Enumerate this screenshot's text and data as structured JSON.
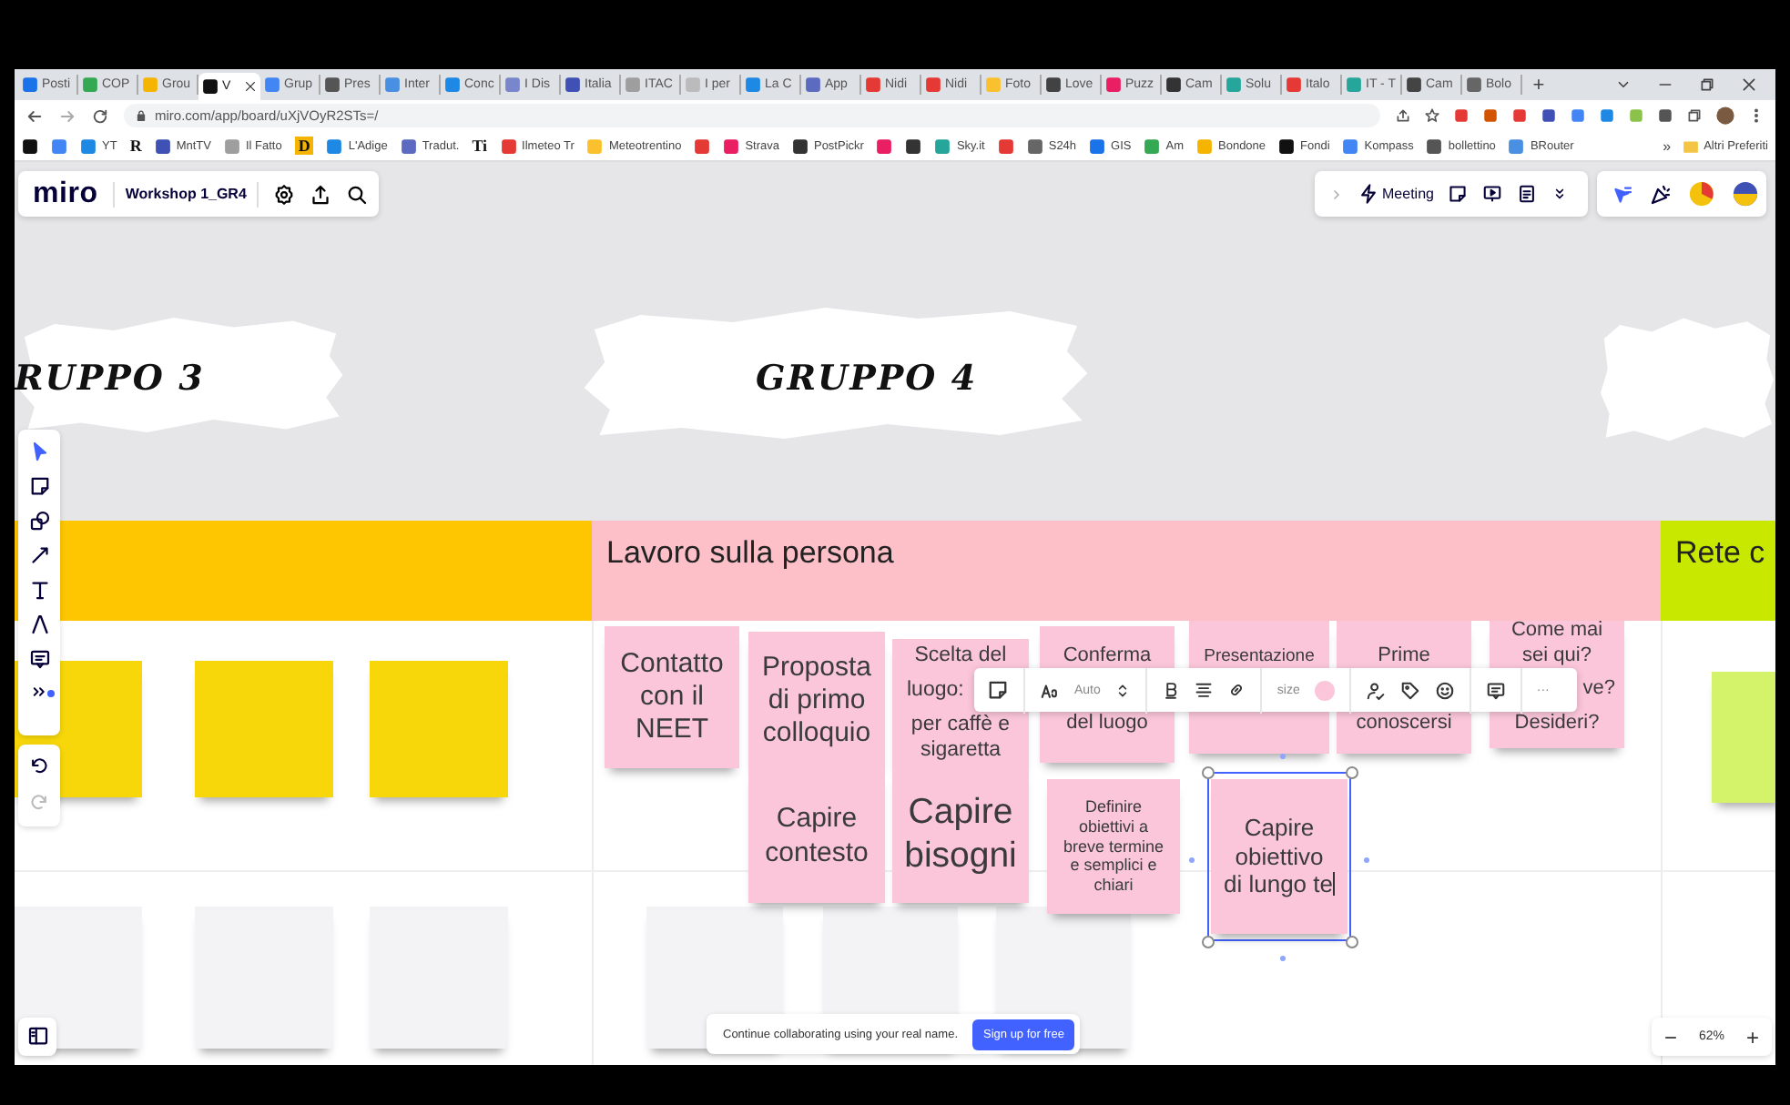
{
  "browser": {
    "tabs": [
      {
        "title": "Posti",
        "selected": false
      },
      {
        "title": "COP",
        "selected": false
      },
      {
        "title": "Grou",
        "selected": false
      },
      {
        "title": "V",
        "selected": true
      },
      {
        "title": "Grup",
        "selected": false
      },
      {
        "title": "Pres",
        "selected": false
      },
      {
        "title": "Inter",
        "selected": false
      },
      {
        "title": "Conc",
        "selected": false
      },
      {
        "title": "I Dis",
        "selected": false
      },
      {
        "title": "Italia",
        "selected": false
      },
      {
        "title": "ITAC",
        "selected": false
      },
      {
        "title": "I per",
        "selected": false
      },
      {
        "title": "La C",
        "selected": false
      },
      {
        "title": "App",
        "selected": false
      },
      {
        "title": "Nidi",
        "selected": false
      },
      {
        "title": "Nidi",
        "selected": false
      },
      {
        "title": "Foto",
        "selected": false
      },
      {
        "title": "Love",
        "selected": false
      },
      {
        "title": "Puzz",
        "selected": false
      },
      {
        "title": "Cam",
        "selected": false
      },
      {
        "title": "Solu",
        "selected": false
      },
      {
        "title": "Italo",
        "selected": false
      },
      {
        "title": "IT - T",
        "selected": false
      },
      {
        "title": "Cam",
        "selected": false
      },
      {
        "title": "Bolo",
        "selected": false
      }
    ],
    "new_tab": "+",
    "url": "miro.com/app/board/uXjVOyR2STs=/",
    "bookmarks": [
      {
        "kind": "icon"
      },
      {
        "kind": "icon"
      },
      {
        "kind": "link",
        "label": "YT"
      },
      {
        "kind": "letter",
        "label": "R"
      },
      {
        "kind": "link",
        "label": "MntTV"
      },
      {
        "kind": "link",
        "label": "Il Fatto"
      },
      {
        "kind": "letter",
        "label": "D"
      },
      {
        "kind": "link",
        "label": "L'Adige"
      },
      {
        "kind": "link",
        "label": "Tradut."
      },
      {
        "kind": "letter",
        "label": "Ti"
      },
      {
        "kind": "link",
        "label": "Ilmeteo Tr"
      },
      {
        "kind": "link",
        "label": "Meteotrentino"
      },
      {
        "kind": "icon"
      },
      {
        "kind": "link",
        "label": "Strava"
      },
      {
        "kind": "link",
        "label": "PostPickr"
      },
      {
        "kind": "icon"
      },
      {
        "kind": "icon"
      },
      {
        "kind": "link",
        "label": "Sky.it"
      },
      {
        "kind": "icon"
      },
      {
        "kind": "link",
        "label": "S24h"
      },
      {
        "kind": "link",
        "label": "GIS"
      },
      {
        "kind": "link",
        "label": "Am"
      },
      {
        "kind": "link",
        "label": "Bondone"
      },
      {
        "kind": "link",
        "label": "Fondi"
      },
      {
        "kind": "link",
        "label": "Kompass"
      },
      {
        "kind": "link",
        "label": "bollettino"
      },
      {
        "kind": "link",
        "label": "BRouter"
      }
    ],
    "bookmarks_more": "»",
    "other_bookmarks": "Altri Preferiti"
  },
  "board_bar": {
    "logo": "miro",
    "board_name": "Workshop 1_GR4",
    "meeting": "Meeting"
  },
  "canvas": {
    "group_titles": [
      "RUPPO 3",
      "GRUPPO 4"
    ],
    "lanes": [
      {
        "color": "#fec600"
      },
      {
        "title": "Lavoro sulla persona",
        "color": "#fdbfc8"
      },
      {
        "title": "Rete c",
        "color": "#c9e800"
      }
    ],
    "notes": [
      {
        "kind": "plain",
        "color": "#f7d70a",
        "selected": false
      },
      {
        "kind": "plain",
        "color": "#f7d70a",
        "selected": false
      },
      {
        "kind": "plain",
        "color": "#f7d70a",
        "selected": false
      },
      {
        "kind": "plain",
        "color": "#f3f2f5",
        "selected": false
      },
      {
        "kind": "plain",
        "color": "#f3f2f5",
        "selected": false
      },
      {
        "kind": "plain",
        "color": "#f3f2f5",
        "selected": false
      },
      {
        "kind": "plain",
        "color": "#f3f2f5",
        "selected": false
      },
      {
        "kind": "plain",
        "color": "#f3f2f5",
        "selected": false
      },
      {
        "kind": "plain",
        "color": "#f3f2f5",
        "selected": false
      },
      {
        "kind": "plain",
        "color": "#fbc6da",
        "selected": false,
        "lines": [
          "Contatto",
          "con il",
          "NEET"
        ]
      },
      {
        "kind": "plain",
        "color": "#fbc6da",
        "selected": false,
        "lines": [
          "Proposta",
          "di primo",
          "colloquio"
        ]
      },
      {
        "kind": "covered",
        "color": "#fbc6da",
        "selected": false,
        "upper": [
          "Scelta del"
        ],
        "peek_left": "luogo:",
        "lower": [
          "per caffè e",
          "sigaretta"
        ]
      },
      {
        "kind": "covered",
        "color": "#fbc6da",
        "selected": false,
        "upper": [
          "Conferma"
        ],
        "lower": [
          "del luogo"
        ]
      },
      {
        "kind": "covered",
        "color": "#fbc6da",
        "selected": false,
        "upper": [
          "Presentazione"
        ]
      },
      {
        "kind": "covered",
        "color": "#fbc6da",
        "selected": false,
        "upper": [
          "Prime"
        ],
        "lower": [
          "conoscersi"
        ]
      },
      {
        "kind": "covered",
        "color": "#fbc6da",
        "selected": false,
        "upper": [
          "Come mai",
          "sei qui?"
        ],
        "peek_right": "ve?",
        "lower": [
          "Desideri?"
        ]
      },
      {
        "kind": "plain",
        "color": "#fbc6da",
        "selected": false,
        "lines": [
          "Capire",
          "contesto"
        ]
      },
      {
        "kind": "plain",
        "color": "#fbc6da",
        "selected": false,
        "lines": [
          "Capire",
          "bisogni"
        ]
      },
      {
        "kind": "plain",
        "color": "#fbc6da",
        "selected": false,
        "lines": [
          "Definire",
          "obiettivi a",
          "breve termine",
          "e semplici e",
          "chiari"
        ]
      },
      {
        "kind": "plain",
        "color": "#fbc6da",
        "selected": true,
        "lines": [
          "Capire",
          "obiettivo",
          "di lungo te"
        ]
      },
      {
        "kind": "plain",
        "color": "#d4f26a",
        "selected": false
      }
    ]
  },
  "format_toolbar": {
    "font_size": "Auto",
    "size_label": "size",
    "more": "···"
  },
  "banner": {
    "text": "Continue collaborating using your real name.",
    "button": "Sign up for free"
  },
  "zoom": {
    "minus": "−",
    "level_text": "62%",
    "plus": "+"
  }
}
